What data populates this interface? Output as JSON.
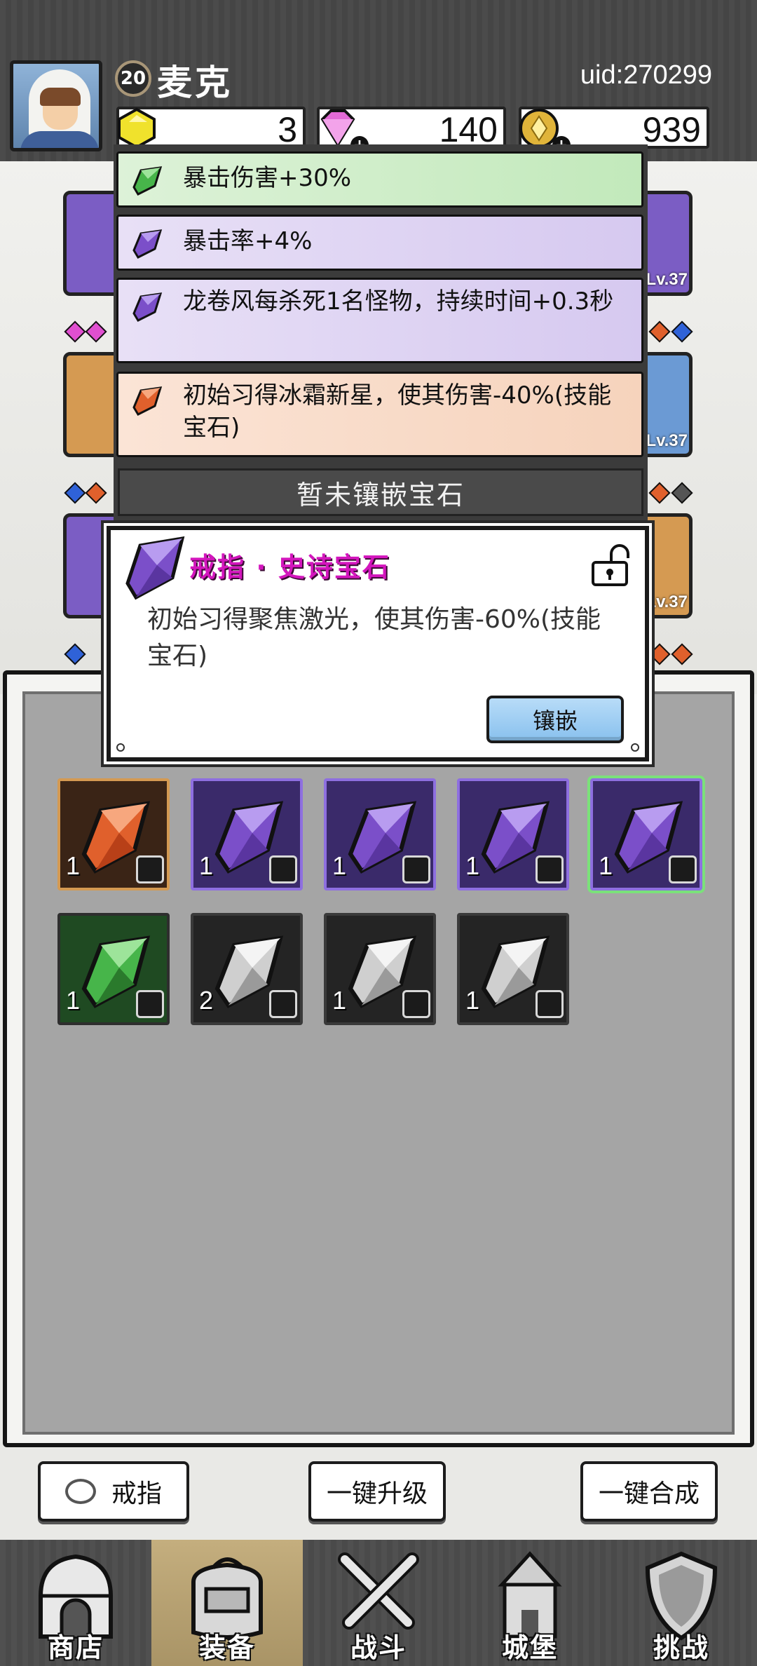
{
  "header": {
    "level": "20",
    "player_name": "麦克",
    "uid": "uid:270299",
    "resources": [
      {
        "name": "yellow-gem-icon",
        "value": "3"
      },
      {
        "name": "diamond-icon",
        "value": "140"
      },
      {
        "name": "gold-coin-icon",
        "value": "939"
      }
    ]
  },
  "equipment": {
    "levels": [
      "Lv.37",
      "Lv.37",
      "Lv.37"
    ]
  },
  "gem_effects": {
    "items": [
      {
        "text": "暴击伤害+30%",
        "color": "#5fc45a"
      },
      {
        "text": "暴击率+4%",
        "color": "#7b4fc9"
      },
      {
        "text": "龙卷风每杀死1名怪物，持续时间+0.3秒",
        "color": "#7b4fc9"
      },
      {
        "text": "初始习得冰霜新星，使其伤害-40%(技能宝石)",
        "color": "#e0602c"
      }
    ],
    "empty_text": "暂未镶嵌宝石"
  },
  "popup": {
    "title": "戒指 · 史诗宝石",
    "description": "初始习得聚焦激光，使其伤害-60%(技能宝石)",
    "inlay_button": "镶嵌",
    "title_color": "#d316bd"
  },
  "inventory": {
    "items": [
      {
        "type": "orange",
        "count": "1"
      },
      {
        "type": "purple",
        "count": "1"
      },
      {
        "type": "purple",
        "count": "1"
      },
      {
        "type": "purple",
        "count": "1"
      },
      {
        "type": "purple",
        "count": "1"
      },
      {
        "type": "green",
        "count": "1"
      },
      {
        "type": "white",
        "count": "2"
      },
      {
        "type": "white",
        "count": "1"
      },
      {
        "type": "white",
        "count": "1"
      }
    ],
    "side_tab_right": "十"
  },
  "buttons": {
    "ring_filter": "戒指",
    "upgrade_all": "一键升级",
    "merge_all": "一键合成"
  },
  "nav": {
    "items": [
      {
        "label": "商店",
        "icon": "shop-icon"
      },
      {
        "label": "装备",
        "icon": "backpack-icon"
      },
      {
        "label": "战斗",
        "icon": "crossed-swords-icon"
      },
      {
        "label": "城堡",
        "icon": "castle-icon"
      },
      {
        "label": "挑战",
        "icon": "shield-icon"
      }
    ],
    "active_index": 1
  }
}
